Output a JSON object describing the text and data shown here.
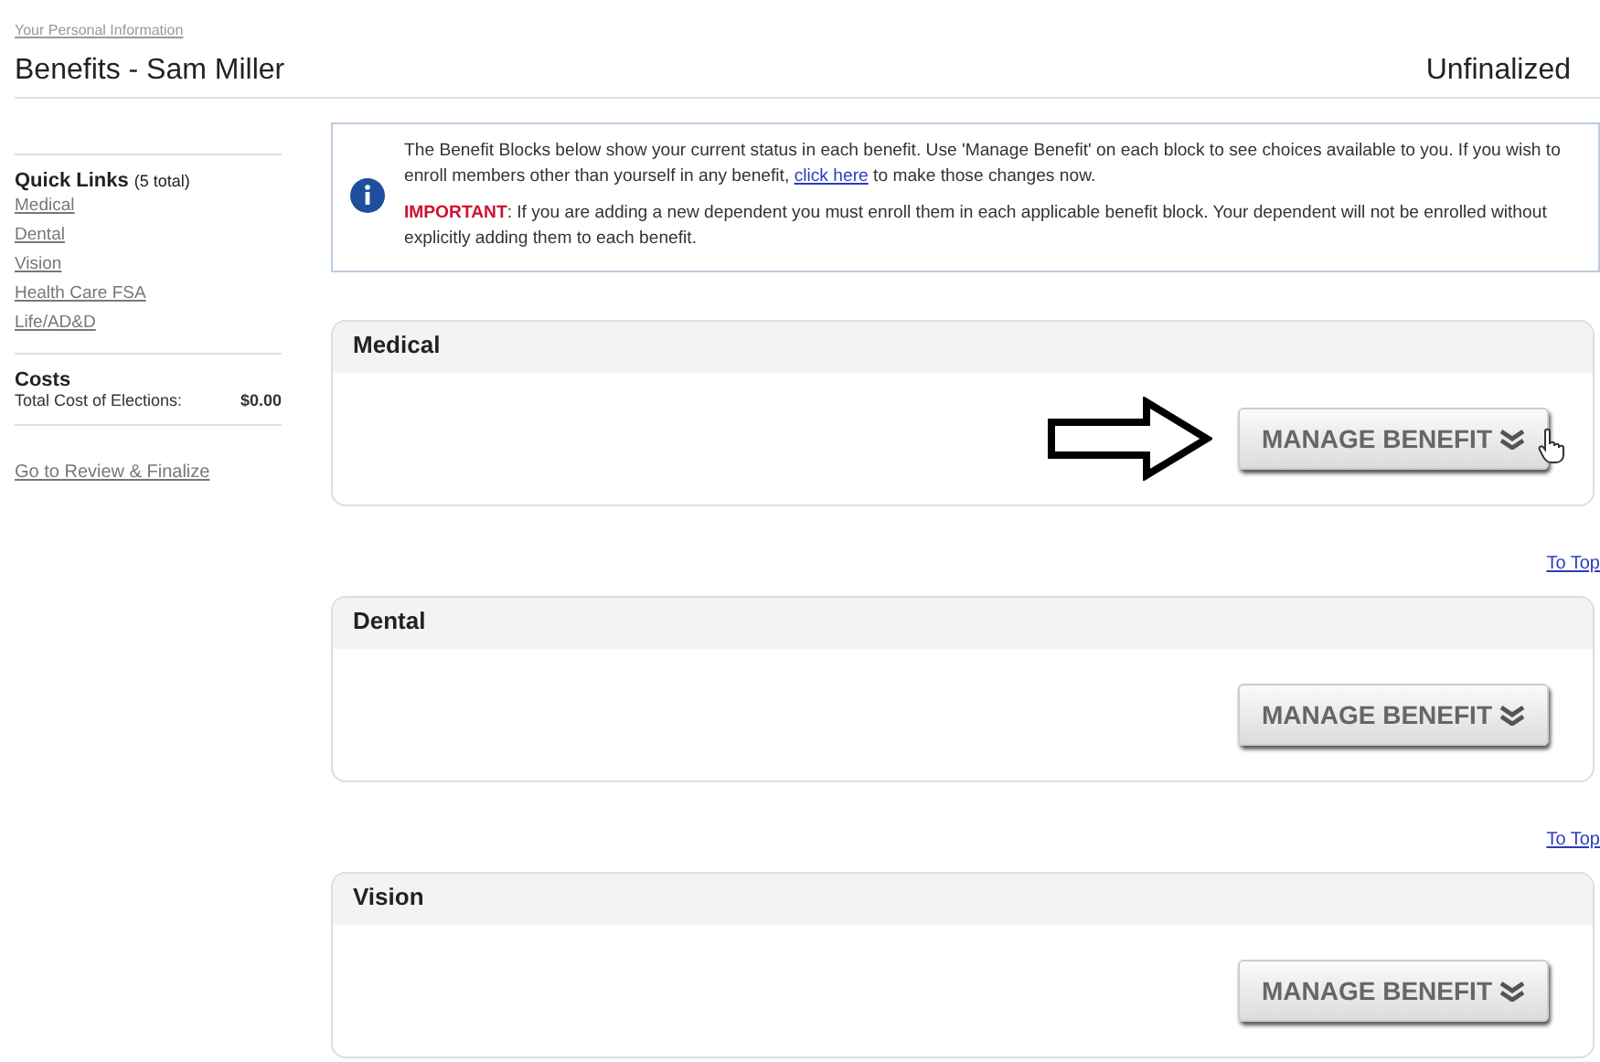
{
  "breadcrumb": "Your Personal Information",
  "title": "Benefits - Sam Miller",
  "status": "Unfinalized",
  "sidebar": {
    "quick_links_title": "Quick Links",
    "quick_links_count": "(5 total)",
    "links": [
      "Medical",
      "Dental",
      "Vision",
      "Health Care FSA",
      "Life/AD&D"
    ],
    "costs_title": "Costs",
    "cost_label": "Total Cost of Elections:",
    "cost_value": "$0.00",
    "review_link": "Go to Review & Finalize"
  },
  "notice": {
    "line1_before": "The Benefit Blocks below show your current status in each benefit. Use 'Manage Benefit' on each block to see choices available to you. If you wish to enroll members other than yourself in any benefit,",
    "link": "click here",
    "line1_after": "to make those changes now.",
    "important_label": "IMPORTANT",
    "important_text": ": If you are adding a new dependent you must enroll them in each applicable benefit block. Your dependent will not be enrolled without explicitly adding them to each benefit."
  },
  "blocks": [
    {
      "title": "Medical",
      "button": "MANAGE BENEFIT",
      "pointed_at": true,
      "to_top": "To Top"
    },
    {
      "title": "Dental",
      "button": "MANAGE BENEFIT",
      "pointed_at": false,
      "to_top": "To Top"
    },
    {
      "title": "Vision",
      "button": "MANAGE BENEFIT",
      "pointed_at": false
    }
  ]
}
